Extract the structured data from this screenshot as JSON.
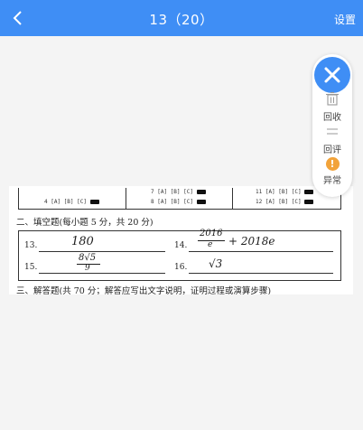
{
  "header": {
    "title": "13（20）",
    "settings_label": "设置"
  },
  "panel": {
    "recycle_label": "回收",
    "rereview_label": "回评",
    "abnormal_label": "异常"
  },
  "paper": {
    "mc_rows": [
      {
        "left": "4 [A] [B] [C]",
        "mid": "8 [A] [B] [C]",
        "right": "12 [A] [B] [C]"
      },
      {
        "left": "",
        "mid": "7 [A] [B] [C]",
        "right": "11 [A] [B] [C]"
      }
    ],
    "section2": "二、填空题(每小题 5 分，共 20 分)",
    "q13_label": "13.",
    "q14_label": "14.",
    "q15_label": "15.",
    "q16_label": "16.",
    "q13_answer": "180",
    "q14_frac_num": "2016",
    "q14_frac_den": "e",
    "q14_tail": "+ 2018e",
    "q15_frac_num": "8√5",
    "q15_frac_den": "9",
    "q16_answer": "√3",
    "section3": "三、解答题(共 70 分；解答应写出文字说明，证明过程或演算步骤)"
  }
}
